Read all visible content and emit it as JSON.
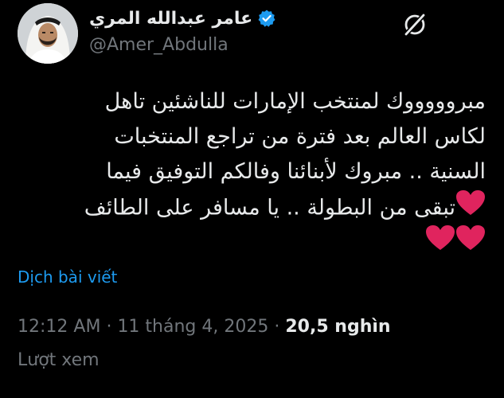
{
  "author": {
    "display_name": "عامر عبدالله المري",
    "handle": "@Amer_Abdulla",
    "verified": true,
    "verified_color": "#1d9bf0"
  },
  "tweet": {
    "lines": [
      "مبروووووك لمنتخب الإمارات للناشئين تاهل",
      "لكاس العالم بعد فترة من تراجع المنتخبات",
      "السنية .. مبروك لأبنائنا وفالكم التوفيق فيما",
      "تبقى من البطولة .. يا مسافر على الطائف"
    ],
    "heart_color": "#e0245e"
  },
  "translate_label": "Dịch bài viết",
  "meta": {
    "time": "12:12 AM",
    "separator": "·",
    "date": "11 tháng 4, 2025",
    "views_count": "20,5 nghìn",
    "views_label": "Lượt xem"
  },
  "icons": {
    "grok": "grok-icon",
    "verified": "verified-badge-icon",
    "heart": "heart-icon"
  }
}
